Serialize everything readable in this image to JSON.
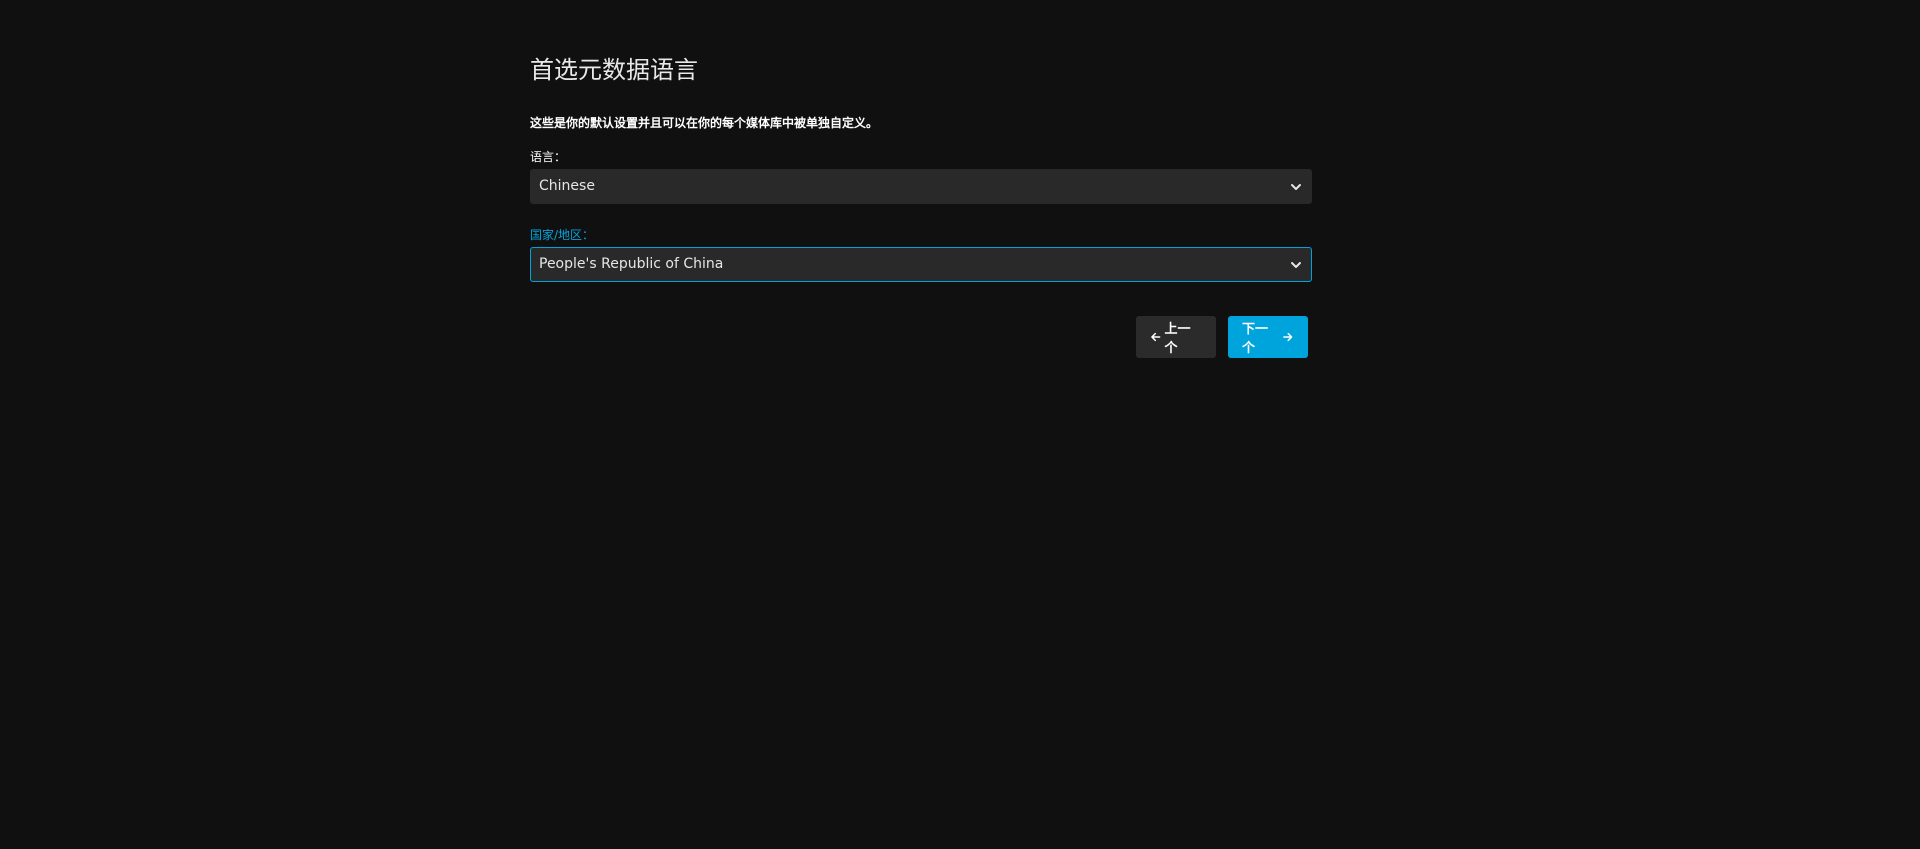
{
  "wizard": {
    "title": "首选元数据语言",
    "description": "这些是你的默认设置并且可以在你的每个媒体库中被单独自定义。",
    "language": {
      "label": "语言：",
      "selected": "Chinese"
    },
    "country": {
      "label": "国家/地区：",
      "selected": "People's Republic of China"
    },
    "buttons": {
      "prev_label": "上一个",
      "next_label": "下一个"
    }
  },
  "icons": {
    "dropdown": "chevron-down-icon",
    "prev": "arrow-left-icon",
    "next": "arrow-right-icon"
  },
  "colors": {
    "background": "#101010",
    "field": "#292929",
    "accent": "#00a4dc",
    "prev_button": "#2b2b2b"
  }
}
